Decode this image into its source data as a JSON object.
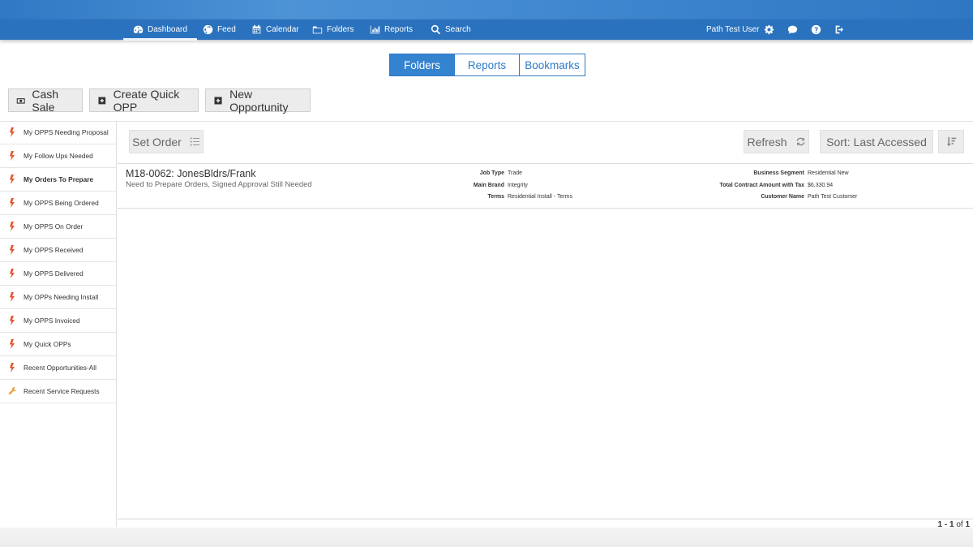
{
  "nav": {
    "items": [
      {
        "label": "Dashboard",
        "icon": "dashboard-icon"
      },
      {
        "label": "Feed",
        "icon": "globe-icon"
      },
      {
        "label": "Calendar",
        "icon": "calendar-icon"
      },
      {
        "label": "Folders",
        "icon": "folder-icon"
      },
      {
        "label": "Reports",
        "icon": "bar-chart-icon"
      },
      {
        "label": "Search",
        "icon": "search-icon"
      }
    ],
    "user": "Path Test User"
  },
  "tabs": [
    "Folders",
    "Reports",
    "Bookmarks"
  ],
  "actions": {
    "cash_sale": "Cash Sale",
    "create_quick_opp": "Create Quick OPP",
    "new_opportunity": "New Opportunity"
  },
  "sidebar": {
    "items": [
      {
        "label": "My OPPS Needing Proposal",
        "icon": "bolt-icon"
      },
      {
        "label": "My Follow Ups Needed",
        "icon": "bolt-icon"
      },
      {
        "label": "My Orders To Prepare",
        "icon": "bolt-icon"
      },
      {
        "label": "My OPPS Being Ordered",
        "icon": "bolt-icon"
      },
      {
        "label": "My OPPS On Order",
        "icon": "bolt-icon"
      },
      {
        "label": "My OPPS Received",
        "icon": "bolt-icon"
      },
      {
        "label": "My OPPS Delivered",
        "icon": "bolt-icon"
      },
      {
        "label": "My OPPs Needing Install",
        "icon": "bolt-icon"
      },
      {
        "label": "My OPPS Invoiced",
        "icon": "bolt-icon"
      },
      {
        "label": "My Quick OPPs",
        "icon": "bolt-icon"
      },
      {
        "label": "Recent Opportunities-All",
        "icon": "bolt-icon"
      },
      {
        "label": "Recent Service Requests",
        "icon": "wrench-icon"
      }
    ]
  },
  "toolbar": {
    "set_order": "Set Order",
    "refresh": "Refresh",
    "sort": "Sort: Last Accessed"
  },
  "record": {
    "title": "M18-0062: JonesBldrs/Frank",
    "subtitle": "Need to Prepare Orders, Signed Approval Still Needed",
    "fields_mid": [
      {
        "k": "Job Type",
        "v": "Trade"
      },
      {
        "k": "Main Brand",
        "v": "Integrity"
      },
      {
        "k": "Terms",
        "v": "Residential Install - Terms"
      }
    ],
    "fields_right": [
      {
        "k": "Business Segment",
        "v": "Residential New"
      },
      {
        "k": "Total Contract Amount with Tax",
        "v": "$6,330.94"
      },
      {
        "k": "Customer Name",
        "v": "Path Test Customer"
      }
    ]
  },
  "pager": {
    "range": "1 - 1",
    "of": "of",
    "total": "1"
  },
  "colors": {
    "nav": "#2a72be",
    "accent": "#3483cf",
    "bolt": "#e2552b",
    "wrench": "#e8a23a"
  }
}
